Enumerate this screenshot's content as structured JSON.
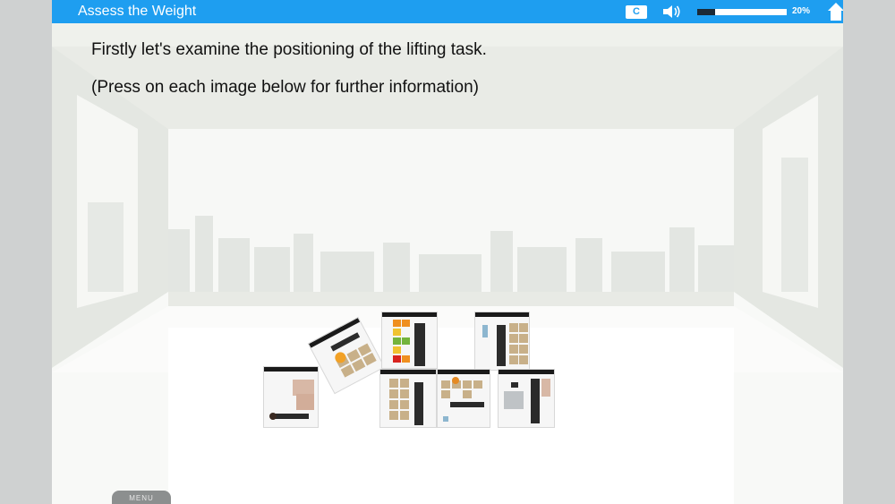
{
  "header": {
    "title": "Assess the Weight",
    "captions_label": "C",
    "progress_value": 20,
    "progress_text": "20%"
  },
  "main": {
    "instruction_line1": "Firstly let's examine the positioning of the lifting task.",
    "instruction_line2": "(Press on each image below for further information)"
  },
  "tiles": [
    {
      "name": "floor-lift-tile"
    },
    {
      "name": "tilted-box-tile"
    },
    {
      "name": "weight-chart-tile"
    },
    {
      "name": "shelf-lift-tile"
    },
    {
      "name": "box-stack-tile"
    },
    {
      "name": "carry-boxes-tile"
    },
    {
      "name": "table-lift-tile"
    }
  ],
  "footer": {
    "menu_label": "MENU"
  },
  "colors": {
    "header_blue": "#1e9ef0",
    "progress_fill": "#1c2a36"
  }
}
